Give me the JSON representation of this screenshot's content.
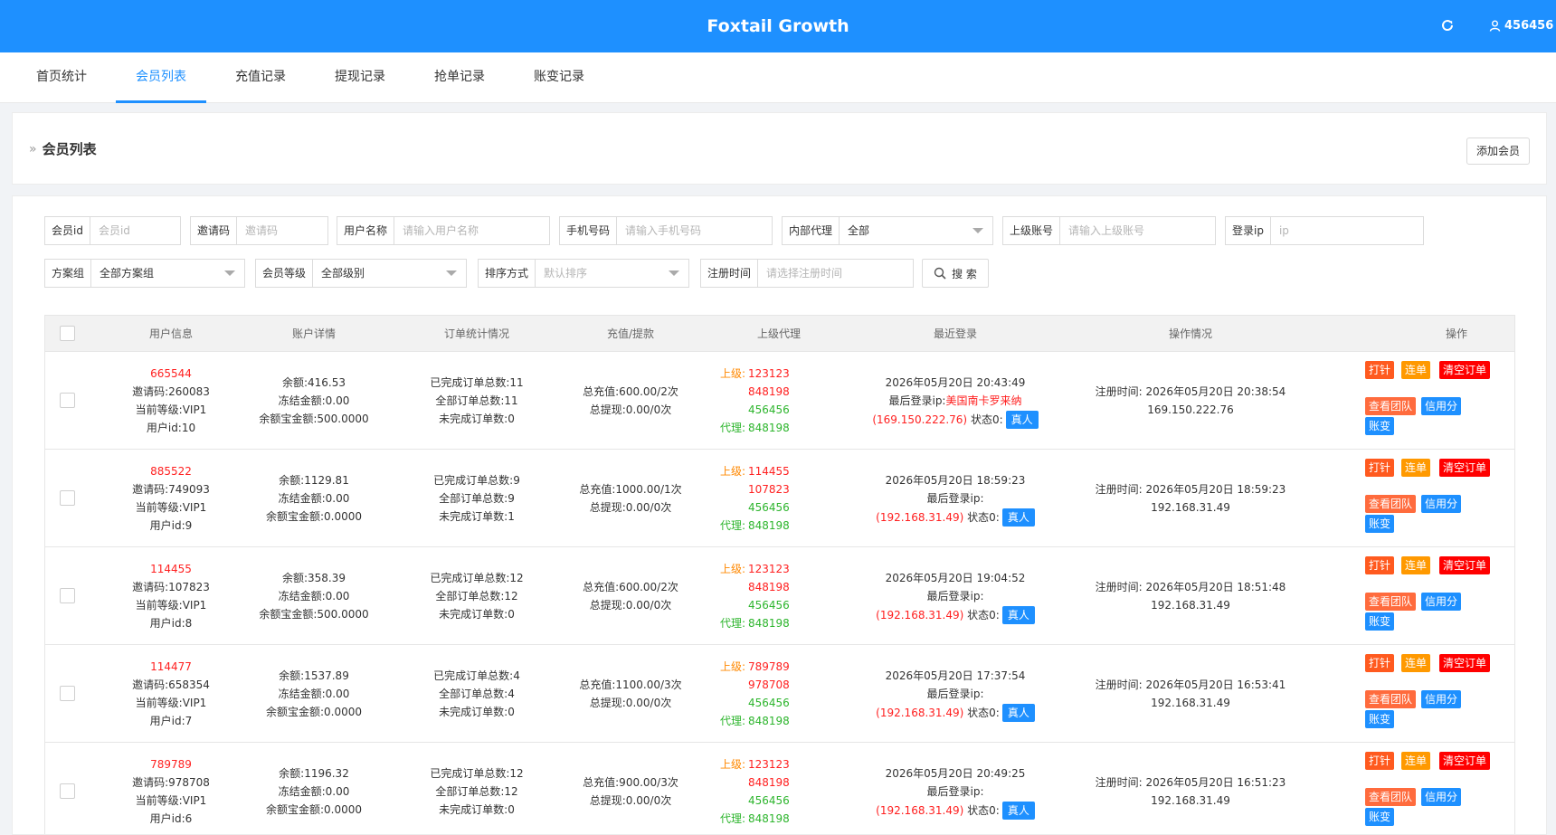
{
  "header": {
    "title": "Foxtail Growth",
    "user": "456456",
    "refresh_icon": "refresh-icon",
    "user_icon": "user-icon"
  },
  "nav": {
    "tabs": [
      "首页统计",
      "会员列表",
      "充值记录",
      "提现记录",
      "抢单记录",
      "账变记录"
    ],
    "active": "会员列表"
  },
  "page": {
    "title": "会员列表",
    "add_button": "添加会员",
    "breadcrumb_icon": "double-chevron-icon"
  },
  "filters": {
    "member_id": {
      "label": "会员id",
      "placeholder": "会员id"
    },
    "invite_code": {
      "label": "邀请码",
      "placeholder": "邀请码"
    },
    "username": {
      "label": "用户名称",
      "placeholder": "请输入用户名称"
    },
    "phone": {
      "label": "手机号码",
      "placeholder": "请输入手机号码"
    },
    "internal_agent": {
      "label": "内部代理",
      "value": "全部"
    },
    "superior": {
      "label": "上级账号",
      "placeholder": "请输入上级账号"
    },
    "login_ip": {
      "label": "登录ip",
      "placeholder": "ip"
    },
    "plan_group": {
      "label": "方案组",
      "value": "全部方案组"
    },
    "member_level": {
      "label": "会员等级",
      "value": "全部级别"
    },
    "sort": {
      "label": "排序方式",
      "value": "默认排序"
    },
    "reg_time": {
      "label": "注册时间",
      "placeholder": "请选择注册时间"
    },
    "search_button": "搜 索"
  },
  "table": {
    "headers": [
      "用户信息",
      "账户详情",
      "订单统计情况",
      "充值/提款",
      "上级代理",
      "最近登录",
      "操作情况",
      "操作"
    ],
    "op_labels": {
      "punch": "打针",
      "chain": "连单",
      "clear": "清空订单",
      "team": "查看团队",
      "credit": "信用分",
      "ledger": "账变"
    },
    "agent_labels": {
      "up": "上级:",
      "proxy": "代理:"
    },
    "real_label": "真人",
    "rows": [
      {
        "username": "665544",
        "invite": "邀请码:260083",
        "level": "当前等级:VIP1",
        "uid": "用户id:10",
        "balance": "余额:416.53",
        "frozen": "冻结金额:0.00",
        "yeb": "余额宝金额:500.0000",
        "done": "已完成订单总数:11",
        "all": "全部订单总数:11",
        "undone": "未完成订单数:0",
        "recharge": "总充值:600.00/2次",
        "withdraw": "总提现:0.00/0次",
        "up1": "123123",
        "up2": "848198",
        "px1": "456456",
        "px2": "848198",
        "login_time": "2026年05月20日 20:43:49",
        "login_ip_label": "最后登录ip:",
        "login_loc": "美国南卡罗来纳",
        "login_ip": "(169.150.222.76)",
        "status": "状态0:",
        "reg_time": "注册时间:  2026年05月20日 20:38:54",
        "reg_ip": "169.150.222.76"
      },
      {
        "username": "885522",
        "invite": "邀请码:749093",
        "level": "当前等级:VIP1",
        "uid": "用户id:9",
        "balance": "余额:1129.81",
        "frozen": "冻结金额:0.00",
        "yeb": "余额宝金额:0.0000",
        "done": "已完成订单总数:9",
        "all": "全部订单总数:9",
        "undone": "未完成订单数:1",
        "recharge": "总充值:1000.00/1次",
        "withdraw": "总提现:0.00/0次",
        "up1": "114455",
        "up2": "107823",
        "px1": "456456",
        "px2": "848198",
        "login_time": "2026年05月20日 18:59:23",
        "login_ip_label": "最后登录ip:",
        "login_loc": "",
        "login_ip": "(192.168.31.49)",
        "status": "状态0:",
        "reg_time": "注册时间:  2026年05月20日 18:59:23",
        "reg_ip": "192.168.31.49"
      },
      {
        "username": "114455",
        "invite": "邀请码:107823",
        "level": "当前等级:VIP1",
        "uid": "用户id:8",
        "balance": "余额:358.39",
        "frozen": "冻结金额:0.00",
        "yeb": "余额宝金额:500.0000",
        "done": "已完成订单总数:12",
        "all": "全部订单总数:12",
        "undone": "未完成订单数:0",
        "recharge": "总充值:600.00/2次",
        "withdraw": "总提现:0.00/0次",
        "up1": "123123",
        "up2": "848198",
        "px1": "456456",
        "px2": "848198",
        "login_time": "2026年05月20日 19:04:52",
        "login_ip_label": "最后登录ip:",
        "login_loc": "",
        "login_ip": "(192.168.31.49)",
        "status": "状态0:",
        "reg_time": "注册时间:  2026年05月20日 18:51:48",
        "reg_ip": "192.168.31.49"
      },
      {
        "username": "114477",
        "invite": "邀请码:658354",
        "level": "当前等级:VIP1",
        "uid": "用户id:7",
        "balance": "余额:1537.89",
        "frozen": "冻结金额:0.00",
        "yeb": "余额宝金额:0.0000",
        "done": "已完成订单总数:4",
        "all": "全部订单总数:4",
        "undone": "未完成订单数:0",
        "recharge": "总充值:1100.00/3次",
        "withdraw": "总提现:0.00/0次",
        "up1": "789789",
        "up2": "978708",
        "px1": "456456",
        "px2": "848198",
        "login_time": "2026年05月20日 17:37:54",
        "login_ip_label": "最后登录ip:",
        "login_loc": "",
        "login_ip": "(192.168.31.49)",
        "status": "状态0:",
        "reg_time": "注册时间:  2026年05月20日 16:53:41",
        "reg_ip": "192.168.31.49"
      },
      {
        "username": "789789",
        "invite": "邀请码:978708",
        "level": "当前等级:VIP1",
        "uid": "用户id:6",
        "balance": "余额:1196.32",
        "frozen": "冻结金额:0.00",
        "yeb": "余额宝金额:0.0000",
        "done": "已完成订单总数:12",
        "all": "全部订单总数:12",
        "undone": "未完成订单数:0",
        "recharge": "总充值:900.00/3次",
        "withdraw": "总提现:0.00/0次",
        "up1": "123123",
        "up2": "848198",
        "px1": "456456",
        "px2": "848198",
        "login_time": "2026年05月20日 20:49:25",
        "login_ip_label": "最后登录ip:",
        "login_loc": "",
        "login_ip": "(192.168.31.49)",
        "status": "状态0:",
        "reg_time": "注册时间:  2026年05月20日 16:51:23",
        "reg_ip": "192.168.31.49"
      }
    ]
  }
}
